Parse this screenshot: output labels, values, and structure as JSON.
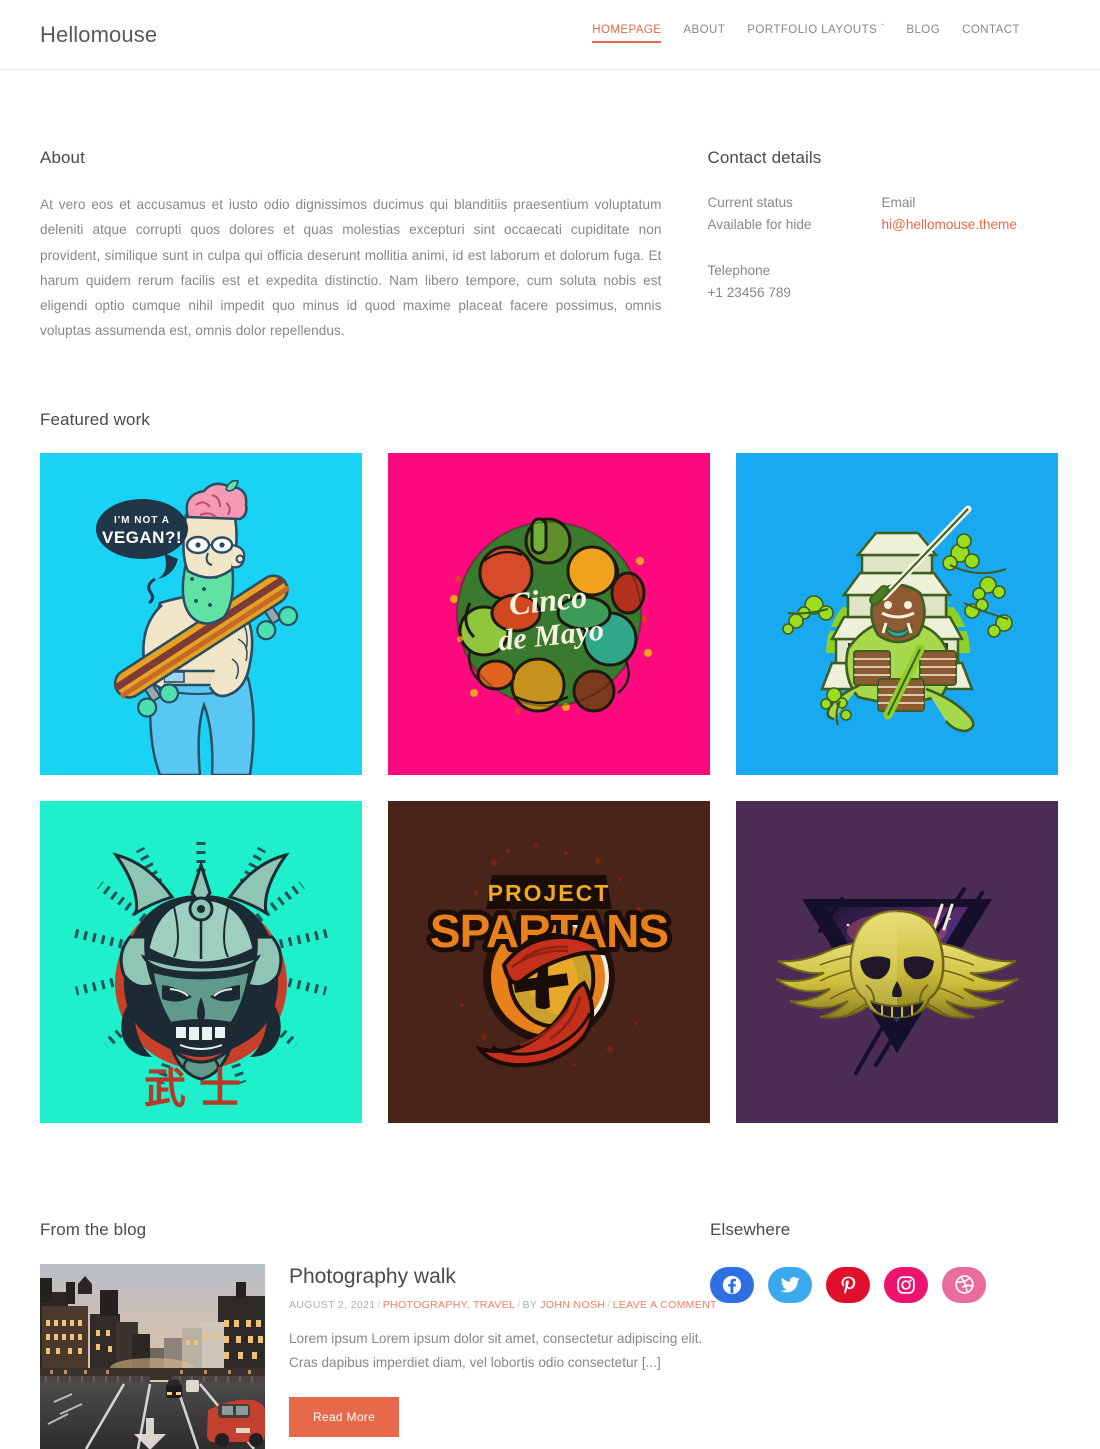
{
  "header": {
    "brand": "Hellomouse",
    "nav": [
      {
        "label": "HOMEPAGE",
        "active": true,
        "caret": ""
      },
      {
        "label": "ABOUT",
        "active": false,
        "caret": ""
      },
      {
        "label": "PORTFOLIO LAYOUTS",
        "active": false,
        "caret": "ˇ"
      },
      {
        "label": "BLOG",
        "active": false,
        "caret": ""
      },
      {
        "label": "CONTACT",
        "active": false,
        "caret": ""
      }
    ]
  },
  "about": {
    "title": "About",
    "text": "At vero eos et accusamus et iusto odio dignissimos ducimus qui blanditiis praesentium voluptatum deleniti atque corrupti quos dolores et quas molestias excepturi sint occaecati cupiditate non provident, similique sunt in culpa qui officia deserunt mollitia animi, id est laborum et dolorum fuga. Et harum quidem rerum facilis est et expedita distinctio. Nam libero tempore, cum soluta nobis est eligendi optio cumque nihil impedit quo minus id quod maxime placeat facere possimus, omnis voluptas assumenda est, omnis dolor repellendus."
  },
  "contact": {
    "title": "Contact details",
    "status_label": "Current status",
    "status_value": "Available for hide",
    "email_label": "Email",
    "email_value": "hi@hellomouse.theme",
    "phone_label": "Telephone",
    "phone_value": "+1 23456 789"
  },
  "featured": {
    "title": "Featured work",
    "items": [
      {
        "name": "vegan-skater",
        "bg": "#19d3f5",
        "caption": "I'M NOT A VEGAN?!"
      },
      {
        "name": "cinco-de-mayo",
        "bg": "#fc0a7e",
        "caption": "Cinco de Mayo"
      },
      {
        "name": "samurai-pagoda",
        "bg": "#18a9f0",
        "caption": ""
      },
      {
        "name": "samurai-mask",
        "bg": "#1ef0cb",
        "caption": "武士"
      },
      {
        "name": "project-spartans",
        "bg": "#4a2418",
        "caption": "PROJECT SPARTANS"
      },
      {
        "name": "winged-skull",
        "bg": "#4b2c54",
        "caption": ""
      }
    ]
  },
  "blog": {
    "title": "From the blog",
    "post": {
      "title": "Photography walk",
      "date": "AUGUST 2, 2021",
      "categories": "PHOTOGRAPHY, TRAVEL",
      "by_prefix": "BY",
      "author": "JOHN NOSH",
      "comment_link": "LEAVE A COMMENT",
      "excerpt": "Lorem ipsum Lorem ipsum dolor sit amet, consectetur adipiscing elit. Cras dapibus imperdiet diam, vel lobortis odio consectetur [...]",
      "read_more": "Read More",
      "thumb_alt": "city street at dusk"
    }
  },
  "elsewhere": {
    "title": "Elsewhere",
    "socials": [
      {
        "name": "facebook",
        "color": "#2f6fe4"
      },
      {
        "name": "twitter",
        "color": "#3ba9ee"
      },
      {
        "name": "pinterest",
        "color": "#e0102c"
      },
      {
        "name": "instagram",
        "color": "#ed1470"
      },
      {
        "name": "dribbble",
        "color": "#ea6c9c"
      }
    ]
  },
  "colors": {
    "accent": "#e8684a",
    "text": "#84888c",
    "heading": "#4a4b4d"
  }
}
